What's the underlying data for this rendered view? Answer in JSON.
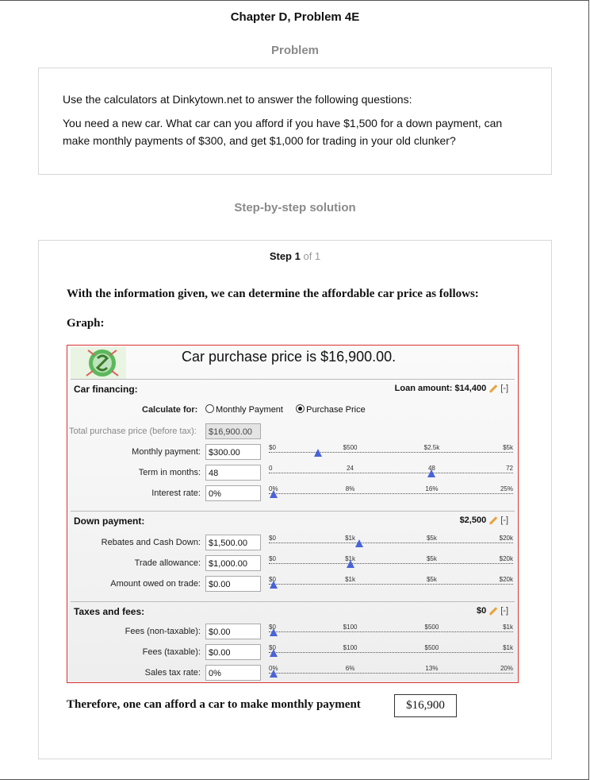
{
  "page": {
    "title": "Chapter D, Problem 4E",
    "problem_heading": "Problem",
    "solution_heading": "Step-by-step solution"
  },
  "problem": {
    "line1": "Use the calculators at Dinkytown.net to answer the following questions:",
    "line2": "You need a new car. What car can you afford if you have $1,500 for a down payment, can make monthly payments of $300, and get $1,000 for trading in your old clunker?"
  },
  "step": {
    "label": "Step 1",
    "of": "of 1",
    "intro": "With the information given, we can determine the affordable car price as follows:",
    "graph_label": "Graph:",
    "conclusion": "Therefore, one can afford a car to make monthly payment",
    "answer": "$16,900"
  },
  "calculator": {
    "headline": "Car purchase price is $16,900.00.",
    "financing": {
      "title": "Car financing:",
      "loan_amount": "Loan amount: $14,400",
      "collapse": "[-]",
      "calculate_for_label": "Calculate for:",
      "option_monthly": "Monthly Payment",
      "option_purchase": "Purchase Price",
      "selected": "Purchase Price",
      "total_price_label": "Total purchase price (before tax):",
      "total_price_value": "$16,900.00",
      "rows": [
        {
          "label": "Monthly payment:",
          "value": "$300.00",
          "ticks": [
            "$0",
            "$500",
            "$2.5k",
            "$5k"
          ],
          "thumb": 0.2
        },
        {
          "label": "Term in months:",
          "value": "48",
          "ticks": [
            "0",
            "24",
            "48",
            "72"
          ],
          "thumb": 0.667
        },
        {
          "label": "Interest rate:",
          "value": "0%",
          "ticks": [
            "0%",
            "8%",
            "16%",
            "25%"
          ],
          "thumb": 0.0
        }
      ]
    },
    "down_payment": {
      "title": "Down payment:",
      "total": "$2,500",
      "collapse": "[-]",
      "rows": [
        {
          "label": "Rebates and Cash Down:",
          "value": "$1,500.00",
          "ticks": [
            "$0",
            "$1k",
            "$5k",
            "$20k"
          ],
          "thumb": 0.37
        },
        {
          "label": "Trade allowance:",
          "value": "$1,000.00",
          "ticks": [
            "$0",
            "$1k",
            "$5k",
            "$20k"
          ],
          "thumb": 0.333
        },
        {
          "label": "Amount owed on trade:",
          "value": "$0.00",
          "ticks": [
            "$0",
            "$1k",
            "$5k",
            "$20k"
          ],
          "thumb": 0.0
        }
      ]
    },
    "taxes": {
      "title": "Taxes and fees:",
      "total": "$0",
      "collapse": "[-]",
      "rows": [
        {
          "label": "Fees (non-taxable):",
          "value": "$0.00",
          "ticks": [
            "$0",
            "$100",
            "$500",
            "$1k"
          ],
          "thumb": 0.0
        },
        {
          "label": "Fees (taxable):",
          "value": "$0.00",
          "ticks": [
            "$0",
            "$100",
            "$500",
            "$1k"
          ],
          "thumb": 0.0
        },
        {
          "label": "Sales tax rate:",
          "value": "0%",
          "ticks": [
            "0%",
            "6%",
            "13%",
            "20%"
          ],
          "thumb": 0.0
        }
      ]
    }
  }
}
